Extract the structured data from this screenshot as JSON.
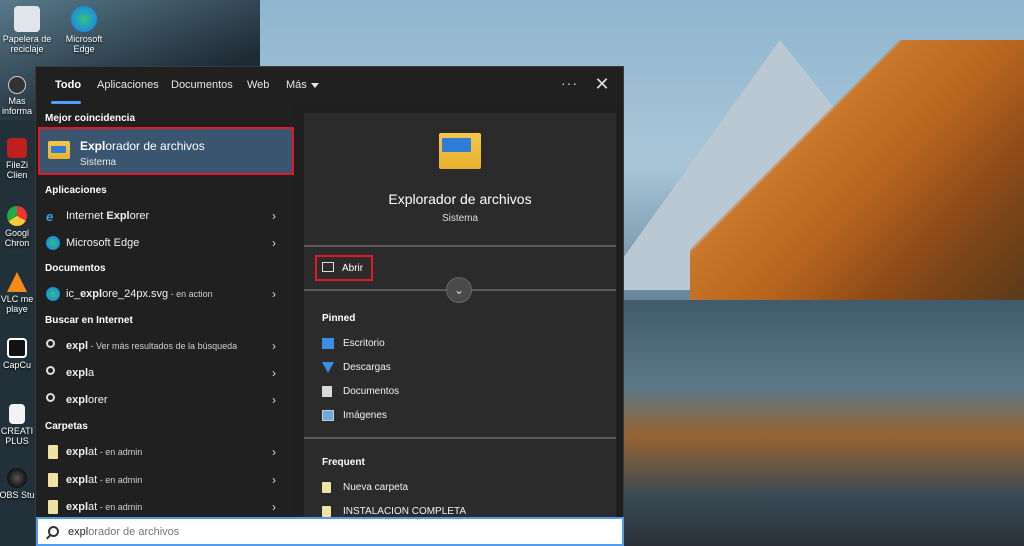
{
  "desktop": {
    "icons": [
      {
        "label": "Papelera de reciclaje",
        "icon": "recycle-bin-icon"
      },
      {
        "label": "Microsoft Edge",
        "icon": "edge-icon"
      },
      {
        "label": "Mas informa",
        "icon": "info-icon"
      },
      {
        "label": "FileZi Clien",
        "icon": "filezilla-icon"
      },
      {
        "label": "Googl Chron",
        "icon": "chrome-icon"
      },
      {
        "label": "VLC me playe",
        "icon": "vlc-icon"
      },
      {
        "label": "CapCu",
        "icon": "capcut-icon"
      },
      {
        "label": "CREATI PLUS",
        "icon": "file-icon"
      },
      {
        "label": "OBS Stu",
        "icon": "obs-icon"
      }
    ]
  },
  "tabs": [
    {
      "label": "Todo"
    },
    {
      "label": "Aplicaciones"
    },
    {
      "label": "Documentos"
    },
    {
      "label": "Web"
    },
    {
      "label": "Más"
    }
  ],
  "toolbar": {
    "more_options": "···",
    "close": "✕"
  },
  "left": {
    "best_match_title": "Mejor coincidencia",
    "best_match": {
      "bold": "Expl",
      "rest": "orador de archivos",
      "sub": "Sistema"
    },
    "apps_title": "Aplicaciones",
    "apps": [
      {
        "pre": "Internet ",
        "bold": "Expl",
        "post": "orer"
      },
      {
        "pre": "Microsoft Edge",
        "bold": "",
        "post": ""
      }
    ],
    "docs_title": "Documentos",
    "docs": [
      {
        "pre": "ic_",
        "bold": "expl",
        "post": "ore_24px.svg",
        "sub": " - en action"
      }
    ],
    "web_title": "Buscar en Internet",
    "web": [
      {
        "bold": "expl",
        "post": "",
        "sub": " - Ver más resultados de la búsqueda"
      },
      {
        "bold": "expl",
        "post": "a",
        "sub": ""
      },
      {
        "bold": "expl",
        "post": "orer",
        "sub": ""
      }
    ],
    "folders_title": "Carpetas",
    "folders": [
      {
        "bold": "expl",
        "post": "at",
        "sub": " - en admin"
      },
      {
        "bold": "expl",
        "post": "at",
        "sub": " - en admin"
      },
      {
        "bold": "expl",
        "post": "at",
        "sub": " - en admin"
      }
    ]
  },
  "right": {
    "title": "Explorador de archivos",
    "subtitle": "Sistema",
    "open_label": "Abrir",
    "pinned_title": "Pinned",
    "pinned": [
      {
        "label": "Escritorio",
        "color": "#3b8ee6"
      },
      {
        "label": "Descargas",
        "color": "#3b8ee6"
      },
      {
        "label": "Documentos",
        "color": "#d9d9d9"
      },
      {
        "label": "Imágenes",
        "color": "#6fa8dc"
      }
    ],
    "frequent_title": "Frequent",
    "frequent": [
      {
        "label": "Nueva carpeta"
      },
      {
        "label": "INSTALACION COMPLETA"
      }
    ]
  },
  "search": {
    "typed": "expl",
    "completion": "orador de archivos"
  }
}
